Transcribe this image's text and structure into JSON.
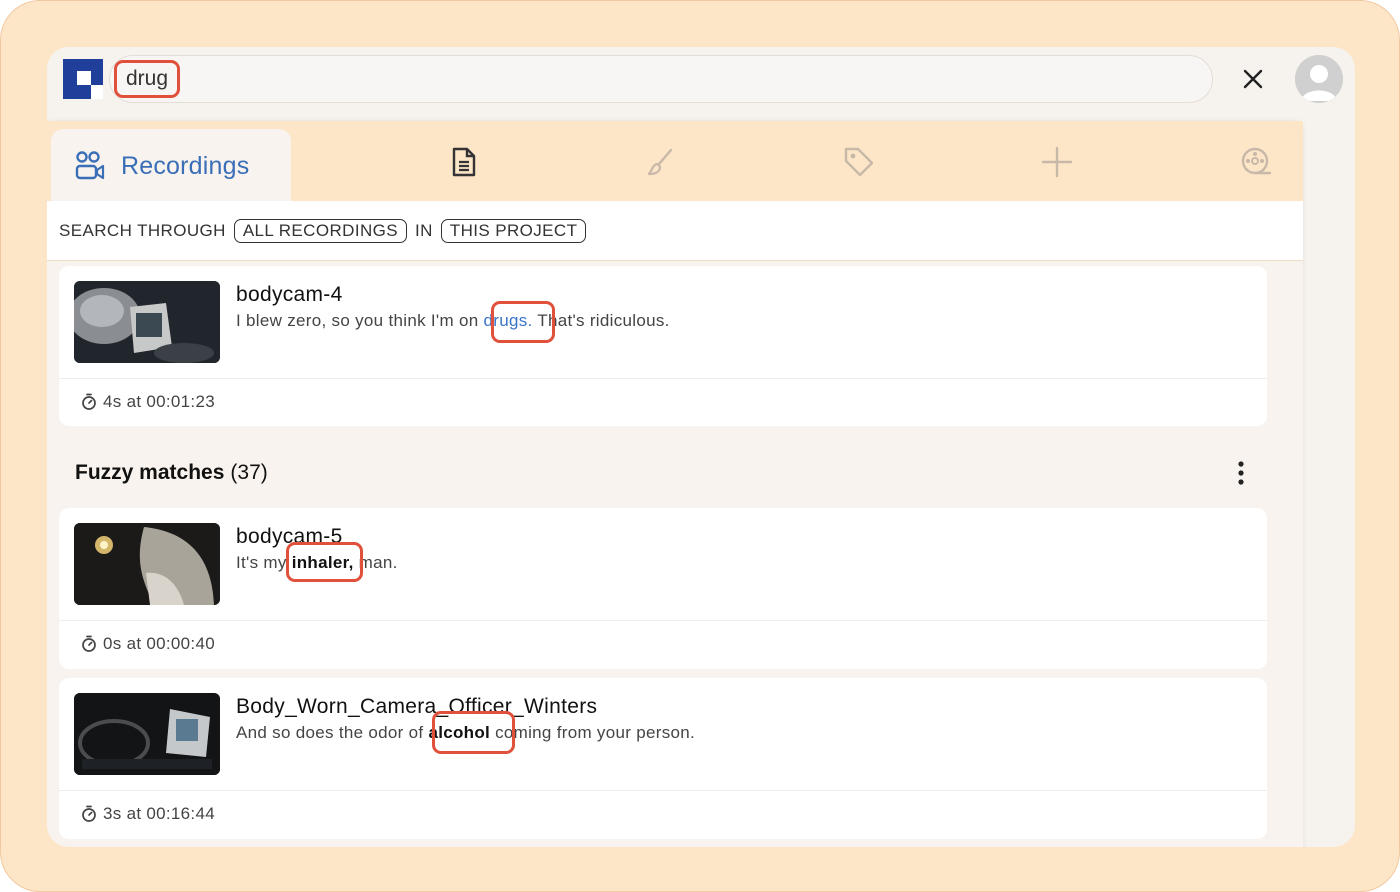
{
  "search": {
    "value": "drug",
    "placeholder": ""
  },
  "tabs": {
    "active_label": "Recordings",
    "icons": [
      "document-icon",
      "brush-icon",
      "tag-icon",
      "plus-icon",
      "film-reel-icon"
    ]
  },
  "scope": {
    "prefix": "SEARCH THROUGH",
    "target": "ALL RECORDINGS",
    "middle": "IN",
    "location": "THIS PROJECT"
  },
  "exact_result": {
    "title": "bodycam-4",
    "snippet_before": "I blew zero, so you think I'm on ",
    "snippet_match": "drugs.",
    "snippet_after": " That's ridiculous.",
    "meta": "4s at 00:01:23"
  },
  "fuzzy": {
    "heading": "Fuzzy matches",
    "count": "(37)",
    "results": [
      {
        "title": "bodycam-5",
        "snippet_before": "It's my ",
        "snippet_match": "inhaler,",
        "snippet_after": " man.",
        "meta": "0s at 00:00:40"
      },
      {
        "title": "Body_Worn_Camera_Officer_Winters",
        "snippet_before": "And so does the odor of ",
        "snippet_match": "alcohol",
        "snippet_after": " coming from your person.",
        "meta": "3s at 00:16:44"
      }
    ]
  },
  "colors": {
    "accent": "#3a6fb8",
    "highlight_ring": "#e0503a",
    "frame": "#fde5c8",
    "brand": "#1f3f9a"
  }
}
